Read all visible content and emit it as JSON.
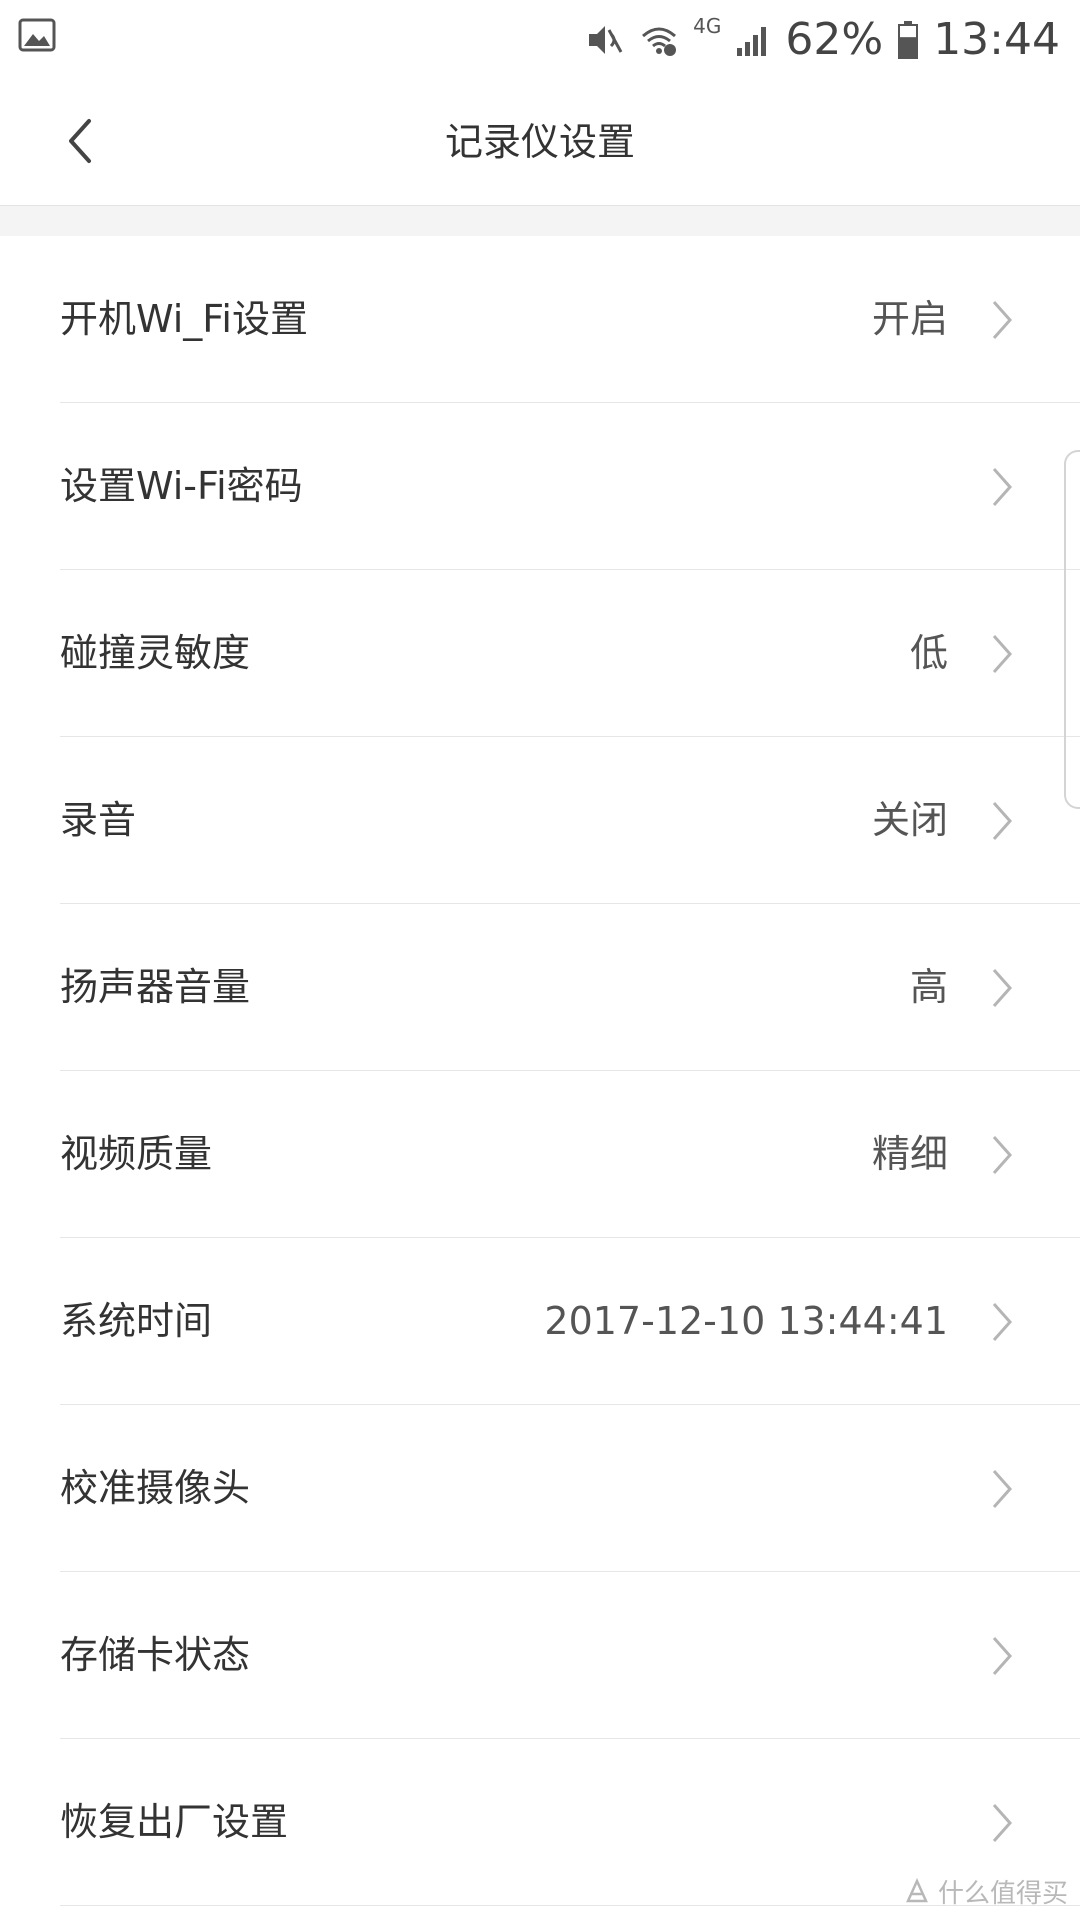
{
  "status_bar": {
    "icons": [
      "gallery-icon",
      "mute-icon",
      "wifi-icon",
      "network-4g-icon",
      "signal-icon",
      "battery-icon"
    ],
    "network_label": "4G",
    "battery_percent": "62%",
    "battery_level": 0.62,
    "time": "13:44"
  },
  "header": {
    "title": "记录仪设置",
    "back_icon": "chevron-left-icon"
  },
  "settings": [
    {
      "label": "开机Wi_Fi设置",
      "value": "开启"
    },
    {
      "label": "设置Wi-Fi密码",
      "value": ""
    },
    {
      "label": "碰撞灵敏度",
      "value": "低"
    },
    {
      "label": "录音",
      "value": "关闭"
    },
    {
      "label": "扬声器音量",
      "value": "高"
    },
    {
      "label": "视频质量",
      "value": "精细"
    },
    {
      "label": "系统时间",
      "value": "2017-12-10 13:44:41"
    },
    {
      "label": "校准摄像头",
      "value": ""
    },
    {
      "label": "存储卡状态",
      "value": ""
    },
    {
      "label": "恢复出厂设置",
      "value": ""
    }
  ],
  "watermark": {
    "text": "什么值得买"
  },
  "colors": {
    "text_primary": "#333333",
    "text_value": "#555555",
    "chevron": "#b5b5b5",
    "divider": "#e6e6e6",
    "gap": "#f4f4f4"
  }
}
